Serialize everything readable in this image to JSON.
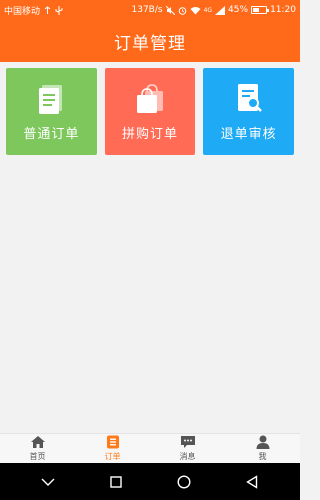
{
  "status_bar": {
    "carrier": "中国移动",
    "speed": "137B/s",
    "network": "4G",
    "battery": "45%",
    "battery_level": 0.45,
    "time": "11:20"
  },
  "header": {
    "title": "订单管理"
  },
  "tiles": [
    {
      "label": "普通订单",
      "color": "#7dc75d",
      "icon": "document-icon"
    },
    {
      "label": "拼购订单",
      "color": "#ff6b55",
      "icon": "shopping-bag-icon"
    },
    {
      "label": "退单审核",
      "color": "#1faaf5",
      "icon": "search-document-icon"
    }
  ],
  "tab_bar": {
    "items": [
      {
        "label": "首页",
        "icon": "home-icon",
        "active": false
      },
      {
        "label": "订单",
        "icon": "order-list-icon",
        "active": true
      },
      {
        "label": "消息",
        "icon": "message-icon",
        "active": false
      },
      {
        "label": "我",
        "icon": "person-icon",
        "active": false
      }
    ],
    "active_color": "#ff7a1a"
  },
  "colors": {
    "brand": "#ff6a1a"
  }
}
